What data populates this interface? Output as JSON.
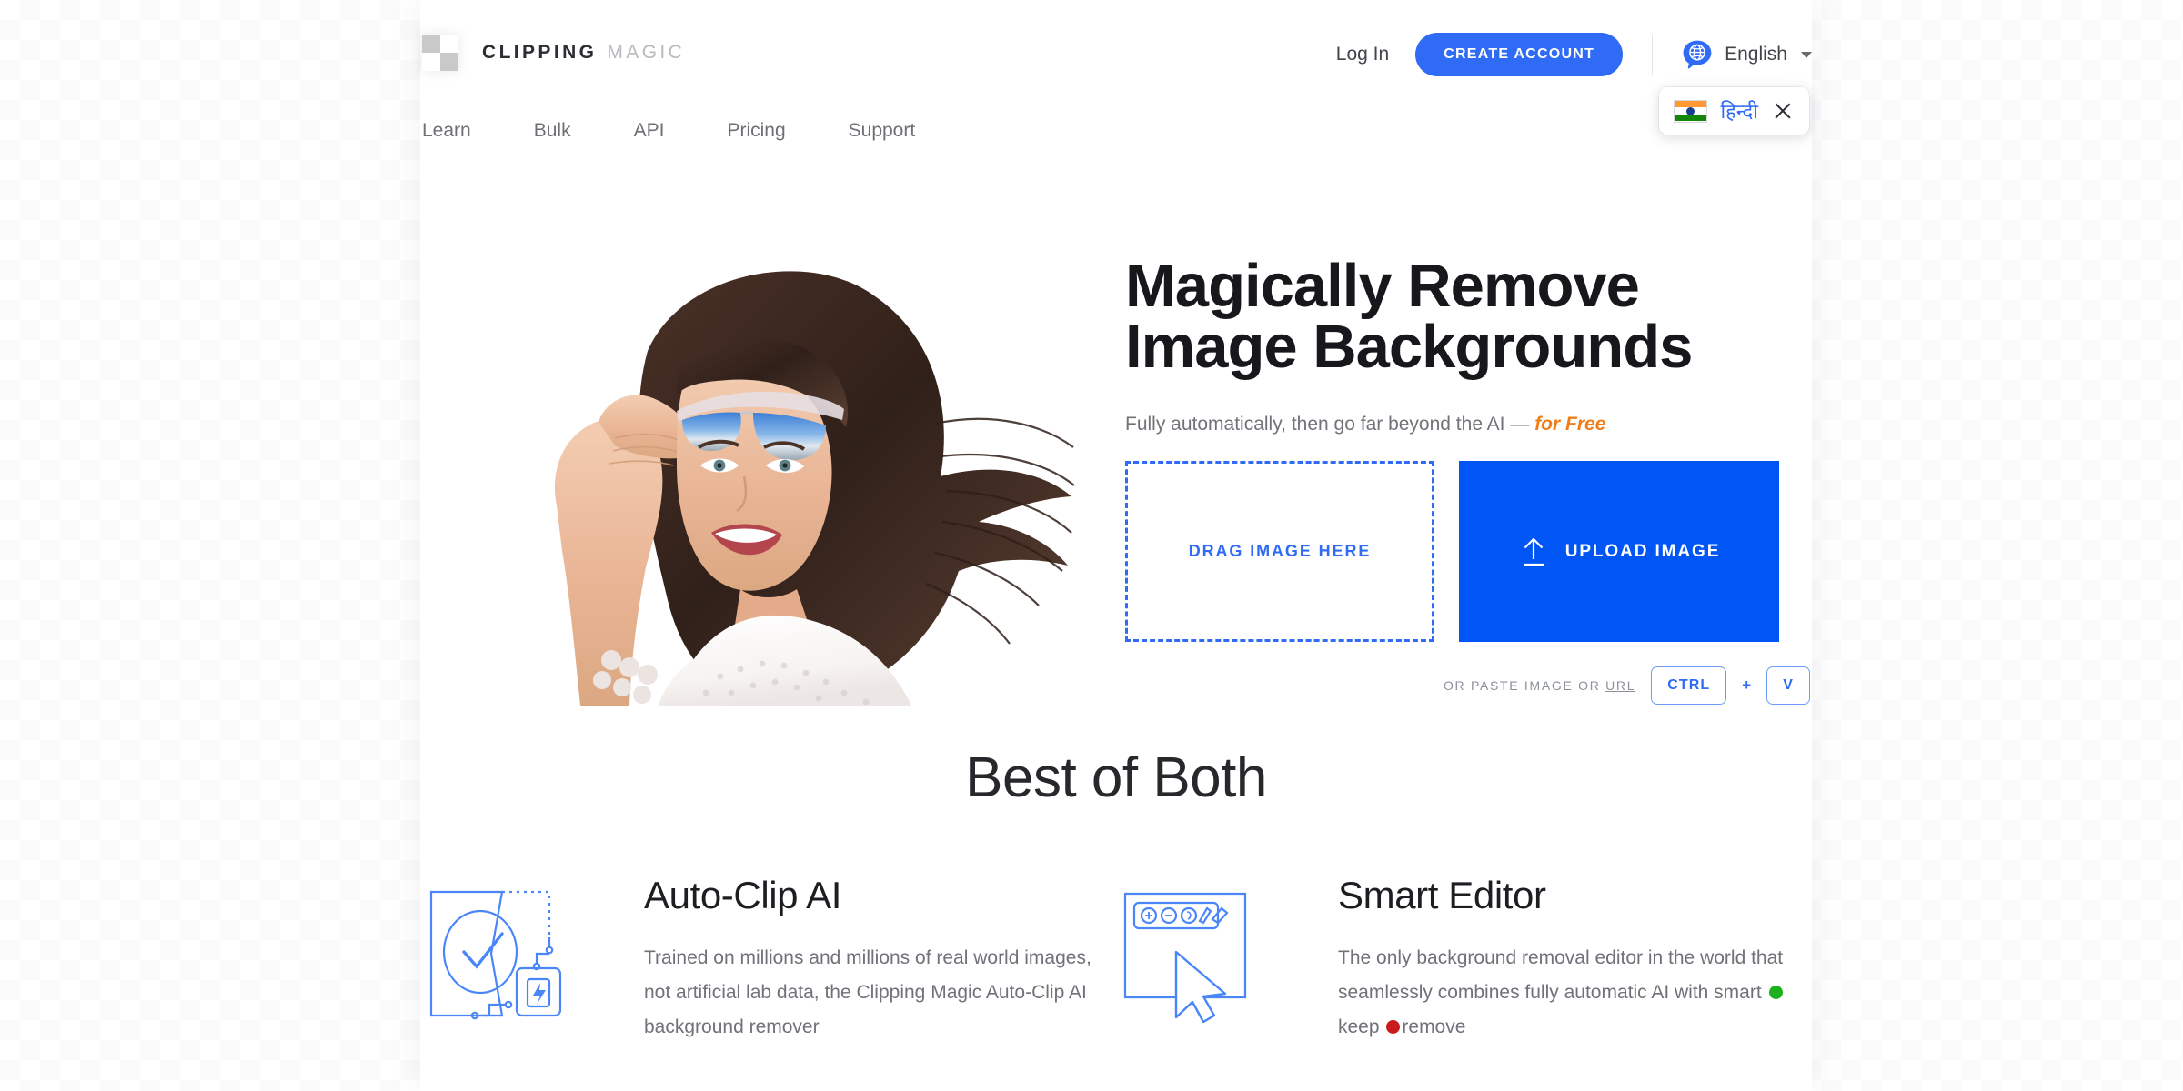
{
  "brand": {
    "name_strong": "CLIPPING",
    "name_light": "MAGIC",
    "logo_icon": "checkerboard-logo-icon",
    "accent_blue": "#2f6bf5",
    "upload_blue": "#0055f5",
    "accent_orange": "#f07d18"
  },
  "header": {
    "nav": [
      {
        "label": "Learn"
      },
      {
        "label": "Bulk"
      },
      {
        "label": "API"
      },
      {
        "label": "Pricing"
      },
      {
        "label": "Support"
      }
    ],
    "login_label": "Log In",
    "create_account_label": "CREATE ACCOUNT",
    "language": {
      "icon": "globe-speech-bubble-icon",
      "current": "English",
      "caret_icon": "chevron-down-icon"
    },
    "language_suggestion": {
      "flag": "india-flag-icon",
      "label": "हिन्दी",
      "close_icon": "close-icon"
    }
  },
  "hero": {
    "photo_alt": "smiling-woman-with-sunglasses-photo",
    "title_line1": "Magically Remove",
    "title_line2": "Image Backgrounds",
    "subtitle_prefix": "Fully automatically, then go far beyond the AI — ",
    "subtitle_accent": "for Free",
    "drop_zone_label": "DRAG IMAGE HERE",
    "upload_button_label": "UPLOAD IMAGE",
    "upload_icon": "upload-arrow-icon",
    "paste_text_prefix": "OR PASTE IMAGE OR ",
    "paste_link_label": "URL",
    "key_ctrl": "CTRL",
    "key_plus": "+",
    "key_v": "V"
  },
  "best_of_both": {
    "title": "Best of Both",
    "features": [
      {
        "icon": "auto-clip-ai-icon",
        "heading": "Auto-Clip AI",
        "text_line1": "Trained on millions and millions of real world",
        "text_line2": "images, not artificial lab data, the Clipping",
        "text_line3": "Magic Auto-Clip AI background remover"
      },
      {
        "icon": "smart-editor-icon",
        "heading": "Smart Editor",
        "text_line1": "The only background removal editor in the",
        "text_line2": "world that seamlessly combines fully",
        "text_line3_a": "automatic AI with smart ",
        "text_line3_keep": "keep",
        "text_line3_b": " ",
        "text_line3_remove": "remove",
        "keep_color": "#1eb11e",
        "remove_color": "#c81b1b"
      }
    ]
  }
}
